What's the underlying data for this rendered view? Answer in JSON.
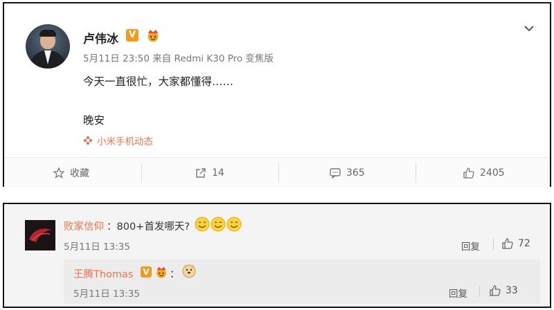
{
  "post": {
    "author": "卢伟冰",
    "verified_badge": "V",
    "meta": "5月11日 23:50 来自 Redmi K30 Pro 变焦版",
    "text_line1": "今天一直很忙，大家都懂得……",
    "text_line2": "晚安",
    "source": "小米手机动态",
    "actions": {
      "favorite_label": "收藏",
      "repost_count": "14",
      "comment_count": "365",
      "like_count": "2405"
    }
  },
  "comment": {
    "author": "败家信仰",
    "text": "：800+首发哪天?",
    "time": "5月11日 13:35",
    "reply_label": "回复",
    "like_count": "72",
    "reply": {
      "author": "王腾Thomas",
      "verified_badge": "V",
      "colon": "：",
      "time": "5月11日 13:35",
      "reply_label": "回复",
      "like_count": "33"
    }
  },
  "colors": {
    "accent": "#eb7350",
    "badge": "#f39a1e",
    "text": "#222222",
    "muted": "#777777"
  },
  "icons": [
    "avatar",
    "verified-v-icon",
    "crown-badge-icon",
    "chevron-down-icon",
    "source-flower-icon",
    "star-icon",
    "share-icon",
    "comment-icon",
    "thumbs-up-icon",
    "smile-emoji-icon",
    "doge-emoji-icon"
  ]
}
